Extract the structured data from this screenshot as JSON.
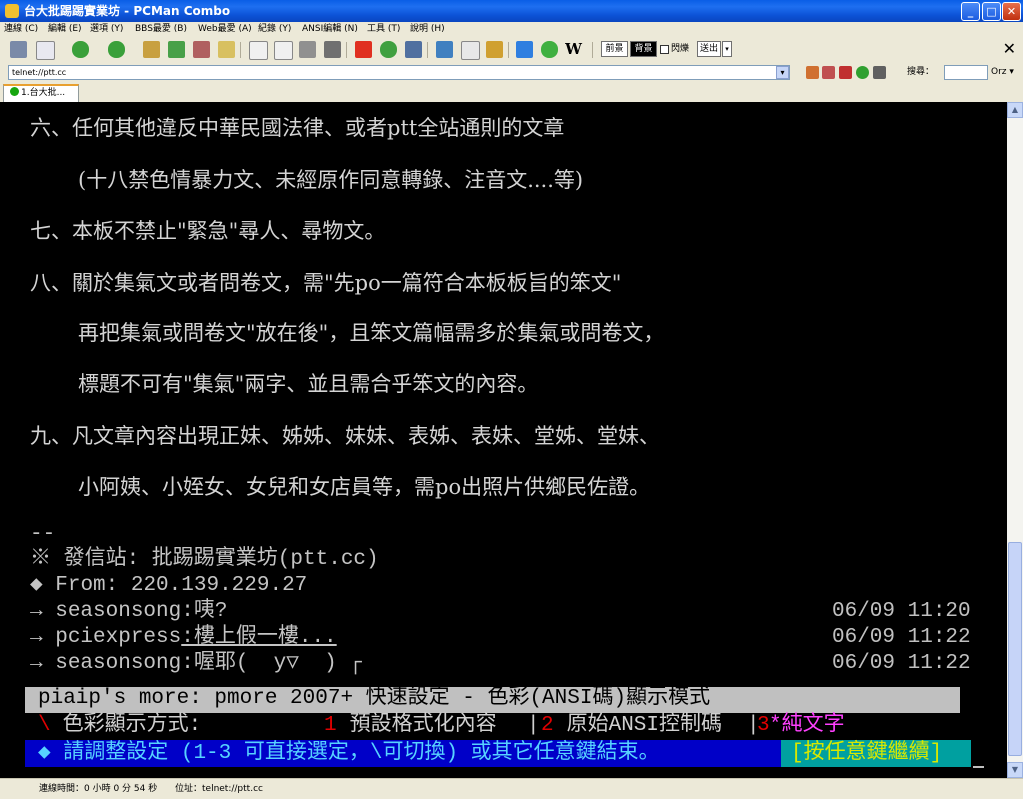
{
  "window": {
    "title": "台大批踢踢實業坊 - PCMan Combo",
    "minimize_glyph": "_",
    "maximize_glyph": "□",
    "close_glyph": "✕"
  },
  "menu": [
    "連線 (C)",
    "編輯 (E)",
    "選項 (Y)",
    "BBS最愛 (B)",
    "Web最愛 (A)",
    "紀錄 (Y)",
    "ANSI編輯 (N)",
    "工具 (T)",
    "說明 (H)"
  ],
  "toolbar": {
    "btn_prev": "前景",
    "btn_bg": "背景",
    "flash_label": "閃爍",
    "btn_send": "送出",
    "close_glyph": "✕"
  },
  "address": {
    "value": "telnet://ptt.cc",
    "search_label": "搜尋：",
    "search_engine": "Orz"
  },
  "tabs": [
    {
      "label": "1.台大批..."
    }
  ],
  "terminal": {
    "rules": [
      "六、任何其他違反中華民國法律、或者ptt全站通則的文章",
      "(十八禁色情暴力文、未經原作同意轉錄、注音文....等)",
      "七、本板不禁止\"緊急\"尋人、尋物文。",
      "八、關於集氣文或者問卷文，需\"先po一篇符合本板板旨的笨文\"",
      "再把集氣或問卷文\"放在後\"，且笨文篇幅需多於集氣或問卷文，",
      "標題不可有\"集氣\"兩字、並且需合乎笨文的內容。",
      "九、凡文章內容出現正妹、姊姊、妹妹、表姊、表妹、堂姊、堂妹、",
      "小阿姨、小姪女、女兒和女店員等，需po出照片供鄉民佐證。"
    ],
    "signature_sep": "--",
    "origin": "※ 發信站: 批踢踢實業坊(ptt.cc)",
    "from": "◆ From: 220.139.229.27",
    "pushes": [
      {
        "arrow": "→",
        "user": "seasonsong",
        "text": ":咦?",
        "time": "06/09 11:20"
      },
      {
        "arrow": "→",
        "user": "pciexpress",
        "text": ":樓上假一樓...",
        "time": "06/09 11:22"
      },
      {
        "arrow": "→",
        "user": "seasonsong",
        "text": ":喔耶(  y▽  ) ┌",
        "time": "06/09 11:22"
      }
    ],
    "pmore_bar": "piaip's more: pmore 2007+ 快速設定 - 色彩(ANSI碼)顯示模式",
    "color_mode": {
      "marker": "\\",
      "label": " 色彩顯示方式:",
      "opt1_key": "1",
      "opt1_label": " 預設格式化內容 ",
      "sep": "|",
      "opt2_key": "2",
      "opt2_label": " 原始ANSI控制碼 ",
      "opt3_key": "3",
      "opt3_label": "*純文字"
    },
    "prompt": "◆ 請調整設定 (1-3 可直接選定，\\可切換) 或其它任意鍵結束。",
    "continue": "[按任意鍵繼續]"
  },
  "status": {
    "connect_time": "連線時間：0 小時 0 分 54 秒",
    "location": "位址：telnet://ptt.cc"
  },
  "colors": {
    "terminal_bg": "#000000",
    "prompt_bg": "#0000c8",
    "continue_bg": "#00a0a0",
    "accent_red": "#e00000",
    "accent_magenta": "#ff40ff"
  }
}
